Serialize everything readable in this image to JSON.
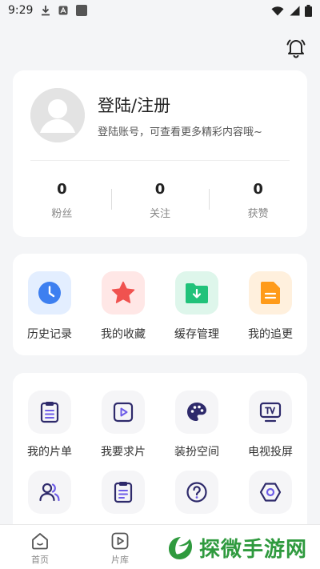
{
  "status_bar": {
    "time": "9:29"
  },
  "profile": {
    "title": "登陆/注册",
    "subtitle": "登陆账号，可查看更多精彩内容哦~",
    "stats": [
      {
        "value": "0",
        "label": "粉丝"
      },
      {
        "value": "0",
        "label": "关注"
      },
      {
        "value": "0",
        "label": "获赞"
      }
    ]
  },
  "quick_actions": [
    {
      "label": "历史记录",
      "icon": "clock-icon",
      "color": "#3d7ff0"
    },
    {
      "label": "我的收藏",
      "icon": "star-icon",
      "color": "#f0524f"
    },
    {
      "label": "缓存管理",
      "icon": "download-folder-icon",
      "color": "#21c27a"
    },
    {
      "label": "我的追更",
      "icon": "document-icon",
      "color": "#ff9b1a"
    }
  ],
  "tools": [
    {
      "label": "我的片单",
      "icon": "clipboard-list-icon"
    },
    {
      "label": "我要求片",
      "icon": "play-icon"
    },
    {
      "label": "装扮空间",
      "icon": "palette-icon"
    },
    {
      "label": "电视投屏",
      "icon": "tv-icon"
    },
    {
      "label": "",
      "icon": "users-icon"
    },
    {
      "label": "",
      "icon": "clipboard-icon"
    },
    {
      "label": "",
      "icon": "help-icon"
    },
    {
      "label": "",
      "icon": "hexagon-settings-icon"
    }
  ],
  "bottom_nav": [
    {
      "label": "首页",
      "icon": "home-icon"
    },
    {
      "label": "片库",
      "icon": "play-square-icon"
    }
  ],
  "watermark": {
    "text": "探微手游网"
  },
  "colors": {
    "tool_icon": "#2e2a6b",
    "tool_accent": "#6d5ce8",
    "page_bg": "#f4f5f7"
  }
}
